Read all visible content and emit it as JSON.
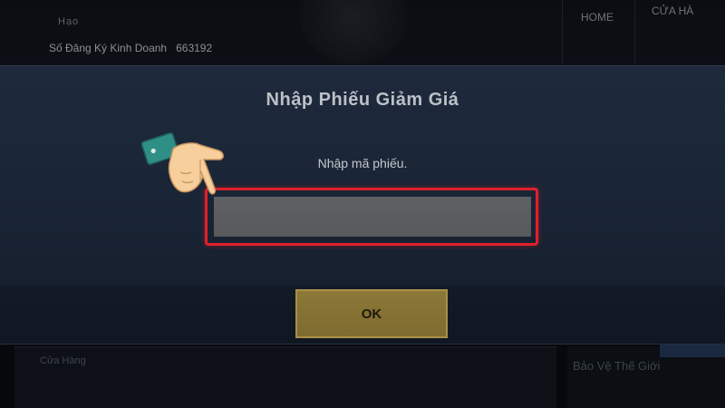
{
  "background": {
    "header_line1": "Hạo",
    "header_line2_label": "Số Đăng Ký Kinh Doanh",
    "header_line2_number": "663192",
    "nav_home": "HOME",
    "nav_second": "CỬA HÀ",
    "bottom_left_text": "Cửa Hàng",
    "bottom_right_text": "Bảo Vệ Thế Giới"
  },
  "dialog": {
    "title": "Nhập Phiếu Giảm Giá",
    "input_label": "Nhập mã phiếu.",
    "input_value": "",
    "ok_label": "OK"
  },
  "colors": {
    "highlight": "#e0202c",
    "ok_button": "#8c7838",
    "dialog_bg": "#1e2a3c"
  },
  "icons": {
    "pointer": "pointing-hand-icon"
  }
}
